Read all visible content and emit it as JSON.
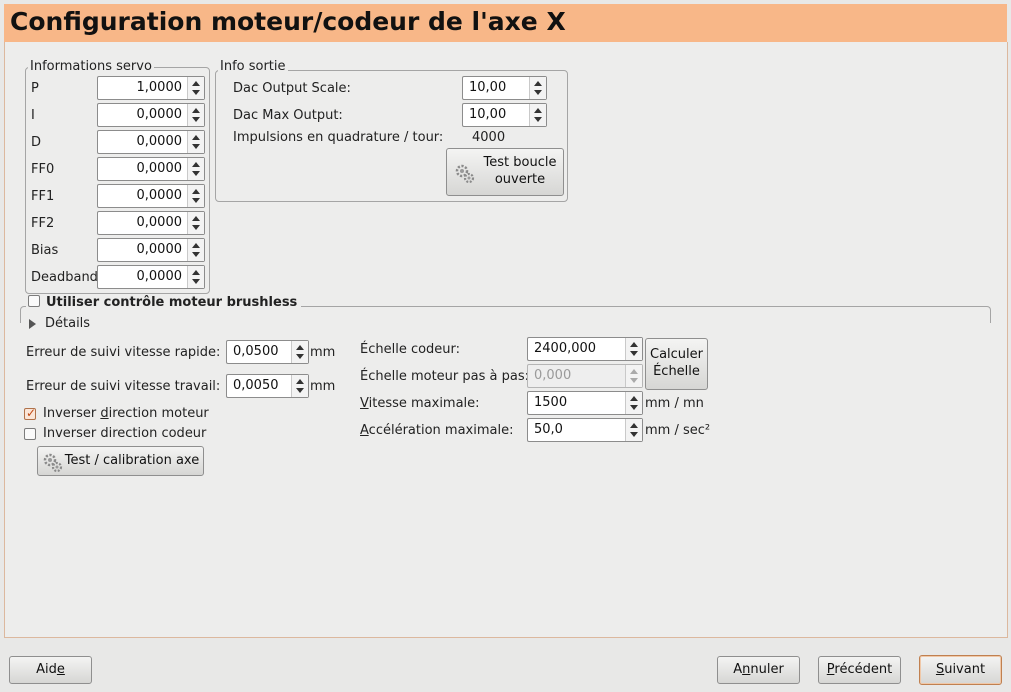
{
  "window": {
    "title": "Configuration moteur/codeur de l'axe X"
  },
  "servo": {
    "label": "Informations servo",
    "rows": [
      {
        "label": "P",
        "value": "1,0000"
      },
      {
        "label": "I",
        "value": "0,0000"
      },
      {
        "label": "D",
        "value": "0,0000"
      },
      {
        "label": "FF0",
        "value": "0,0000"
      },
      {
        "label": "FF1",
        "value": "0,0000"
      },
      {
        "label": "FF2",
        "value": "0,0000"
      },
      {
        "label": "Bias",
        "value": "0,0000"
      },
      {
        "label": "Deadband",
        "value": "0,0000"
      }
    ]
  },
  "output": {
    "label": "Info sortie",
    "dac_scale_label": "Dac Output Scale:",
    "dac_scale_value": "10,00",
    "dac_max_label": "Dac Max Output:",
    "dac_max_value": "10,00",
    "pulses_label": "Impulsions en quadrature / tour:",
    "pulses_value": "4000",
    "open_loop_button": {
      "line1": "Test boucle",
      "line2": "ouverte"
    }
  },
  "brushless": {
    "checkbox_label": "Utiliser contrôle moteur brushless",
    "checked": false,
    "details_label": "Détails"
  },
  "following_error": {
    "rapid_label": "Erreur de suivi vitesse rapide:",
    "rapid_value": "0,0500",
    "rapid_unit": "mm",
    "work_label": "Erreur de suivi vitesse travail:",
    "work_value": "0,0050",
    "work_unit": "mm"
  },
  "direction": {
    "invert_motor_label_a": "Inverser ",
    "invert_motor_label_b": "d",
    "invert_motor_label_c": "irection moteur",
    "invert_motor_checked": true,
    "invert_encoder_label": "Inverser direction codeur",
    "invert_encoder_checked": false,
    "test_axis_button": "Test / calibration axe"
  },
  "scale": {
    "encoder_label": "Échelle codeur:",
    "encoder_value": "2400,000",
    "stepper_label": "Échelle moteur pas à pas:",
    "stepper_value": "0,000",
    "calc_button": {
      "line1": "Calculer",
      "line2": "Échelle"
    },
    "max_speed_label_a": "V",
    "max_speed_label_b": "itesse maximale:",
    "max_speed_value": "1500",
    "max_speed_unit": "mm / mn",
    "max_accel_label_a": "A",
    "max_accel_label_b": "ccélération maximale:",
    "max_accel_value": "50,0",
    "max_accel_unit": "mm / sec²"
  },
  "footer": {
    "help_a": "Aid",
    "help_b": "e",
    "help_c": "",
    "cancel_a": "A",
    "cancel_b": "n",
    "cancel_c": "nuler",
    "prev_a": "",
    "prev_b": "P",
    "prev_c": "récédent",
    "next_a": "",
    "next_b": "S",
    "next_c": "uivant"
  },
  "colors": {
    "header_bg": "#f8b788",
    "accent": "#c04a14"
  }
}
